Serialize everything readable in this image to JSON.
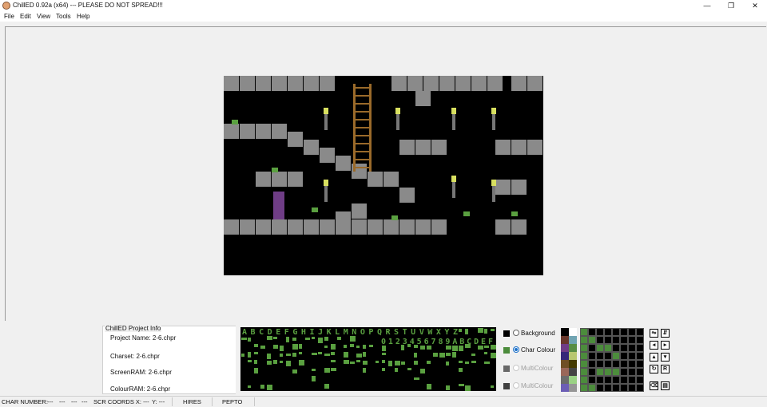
{
  "window": {
    "title": "ChillED 0.92a (x64)  ---  PLEASE DO NOT SPREAD!!!",
    "minimize": "—",
    "restore": "❐",
    "close": "✕"
  },
  "menu": [
    "File",
    "Edit",
    "View",
    "Tools",
    "Help"
  ],
  "project_info": {
    "title": "ChillED Project Info",
    "project_name": "Project Name: 2-6.chpr",
    "charset": "Charset: 2-6.chpr",
    "screen_ram": "ScreenRAM: 2-6.chpr",
    "colour_ram": "ColourRAM: 2-6.chpr"
  },
  "charset_preview": {
    "row1": "ABCDEFGHIJKLMNOPQRSTUVWXYZ",
    "row2": "0123456789ABCDEF"
  },
  "colours": [
    {
      "label": "Background",
      "swatch": "#000000",
      "selected": false,
      "enabled": true
    },
    {
      "label": "Char Colour",
      "swatch": "#4c8c3c",
      "selected": true,
      "enabled": true
    },
    {
      "label": "MultiColour",
      "swatch": "#686868",
      "selected": false,
      "enabled": false
    },
    {
      "label": "MultiColour",
      "swatch": "#404040",
      "selected": false,
      "enabled": false
    }
  ],
  "palette": [
    "#000000",
    "#ffffff",
    "#68372b",
    "#70a4b2",
    "#6f3d86",
    "#588d43",
    "#352879",
    "#b8c76f",
    "#6f4f25",
    "#433900",
    "#9a6759",
    "#444444",
    "#6c6c6c",
    "#9ad284",
    "#6c5eb5",
    "#959595"
  ],
  "char_grid": [
    [
      1,
      0,
      0,
      0,
      0,
      0,
      0,
      0
    ],
    [
      1,
      1,
      0,
      0,
      0,
      0,
      0,
      0
    ],
    [
      1,
      0,
      1,
      1,
      0,
      0,
      0,
      0
    ],
    [
      1,
      0,
      0,
      0,
      1,
      0,
      0,
      0
    ],
    [
      1,
      0,
      0,
      0,
      0,
      0,
      0,
      0
    ],
    [
      1,
      0,
      1,
      1,
      1,
      0,
      0,
      0
    ],
    [
      1,
      0,
      0,
      0,
      0,
      0,
      0,
      0
    ],
    [
      1,
      1,
      0,
      0,
      0,
      0,
      0,
      0
    ]
  ],
  "status": {
    "char_number": "CHAR NUMBER:",
    "char_vals": [
      "---",
      "---",
      "---",
      "---"
    ],
    "scr_coords_x": "SCR COORDS X: ---",
    "y": "Y: ---",
    "mode": "HIRES",
    "palette_name": "PEPTO"
  },
  "colors": {
    "char_green": "#5aa040",
    "stone": "#8a8a8a",
    "ladder": "#9a6a2a",
    "flame": "#d8e060"
  }
}
